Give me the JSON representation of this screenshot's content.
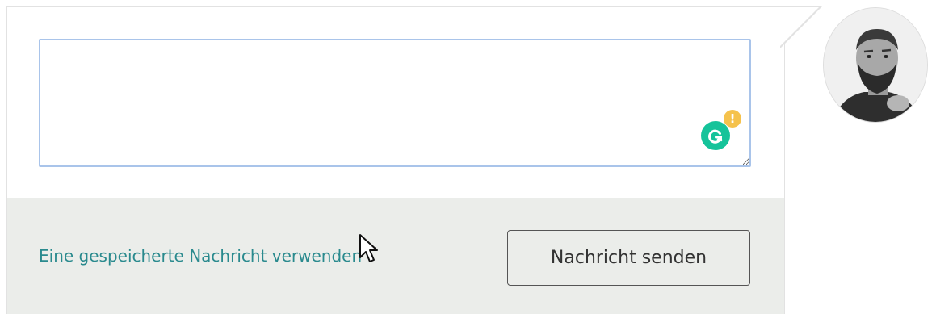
{
  "composer": {
    "message_value": "",
    "message_placeholder": "",
    "saved_message_link": "Eine gespeicherte Nachricht verwenden",
    "send_button_label": "Nachricht senden"
  },
  "grammarly": {
    "icon": "grammarly-icon",
    "badge_icon": "alert-badge-icon",
    "badge_text": "!",
    "badge_color": "#f5c24c",
    "brand_color": "#15c39a"
  },
  "user": {
    "avatar_icon": "user-avatar-photo"
  },
  "colors": {
    "link": "#2a8a8e",
    "footer_background": "#ebedea",
    "input_border_focus": "#a9c4ea"
  }
}
